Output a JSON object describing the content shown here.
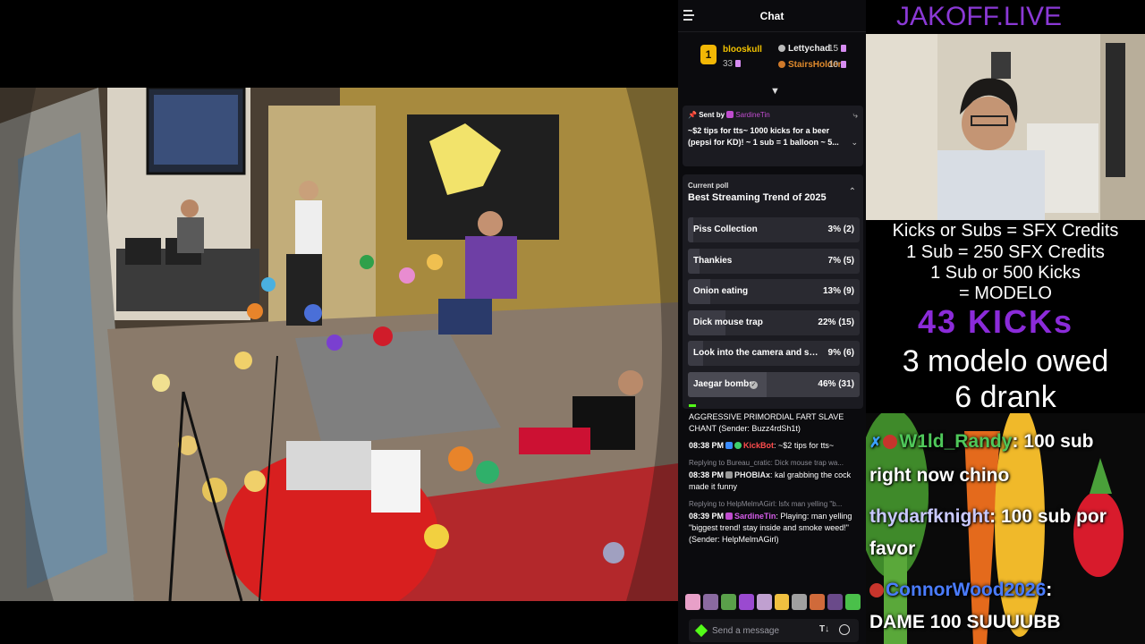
{
  "chat": {
    "title": "Chat",
    "leaderboard": [
      {
        "rank": "1",
        "name": "blooskull",
        "count": "33"
      },
      {
        "name": "Lettychad",
        "count": "15"
      },
      {
        "name": "StairsHolder",
        "count": "10"
      }
    ],
    "pinned": {
      "sent_by_label": "Sent by",
      "sender": "SardineTin",
      "message": "~$2 tips for tts~ 1000 kicks for a beer (pepsi for KD)! ~ 1 sub = 1 balloon ~ 5..."
    },
    "poll": {
      "label": "Current poll",
      "question": "Best Streaming Trend of 2025",
      "options": [
        {
          "name": "Piss Collection",
          "result": "3% (2)",
          "pct": 3
        },
        {
          "name": "Thankies",
          "result": "7% (5)",
          "pct": 7
        },
        {
          "name": "Onion eating",
          "result": "13% (9)",
          "pct": 13
        },
        {
          "name": "Dick mouse trap",
          "result": "22% (15)",
          "pct": 22
        },
        {
          "name": "Look into the camera and say \"...",
          "result": "9% (6)",
          "pct": 9
        },
        {
          "name": "Jaegar bombs",
          "result": "46% (31)",
          "pct": 46
        }
      ]
    },
    "messages": [
      {
        "text": "AGGRESSIVE PRIMORDIAL FART SLAVE CHANT (Sender: Buzz4rdSh1t)"
      },
      {
        "time": "08:38 PM",
        "user": "KickBot",
        "text": ": ~$2 tips for tts~"
      },
      {
        "reply": "Replying to Bureau_cratic: Dick mouse trap wa...",
        "time": "08:38 PM",
        "user": "PHOBIAx",
        "text": ": kal grabbing the cock made it funny"
      },
      {
        "reply": "Replying to HelpMelmAGirl: lsfx man yelling \"b...",
        "time": "08:39 PM",
        "user": "SardineTin",
        "text": ": Playing: man yelling \"biggest trend! stay inside and smoke weed!\" (Sender: HelpMelmAGirl)"
      }
    ],
    "input_placeholder": "Send a message"
  },
  "overlay": {
    "site": "JAKOFF.LIVE",
    "credits": [
      "Kicks or Subs = SFX Credits",
      "1 Sub = 250 SFX Credits",
      "1 Sub or 500 Kicks",
      "= MODELO"
    ],
    "kicks": "43 KICKs",
    "owed": "3 modelo owed",
    "drank": "6 drank",
    "chat": [
      {
        "user": "W1ld_Randy",
        "text": ": 100 sub right now chino"
      },
      {
        "user": "thydarfknight",
        "text": ": 100 sub por favor"
      },
      {
        "user": "ConnorWood2026",
        "text": ": DAME 100 SUUUUBB"
      }
    ]
  },
  "colors": {
    "kick_green": "#53fc18",
    "brand_purple": "#8b39d6",
    "leader_gold": "#f2b705"
  }
}
